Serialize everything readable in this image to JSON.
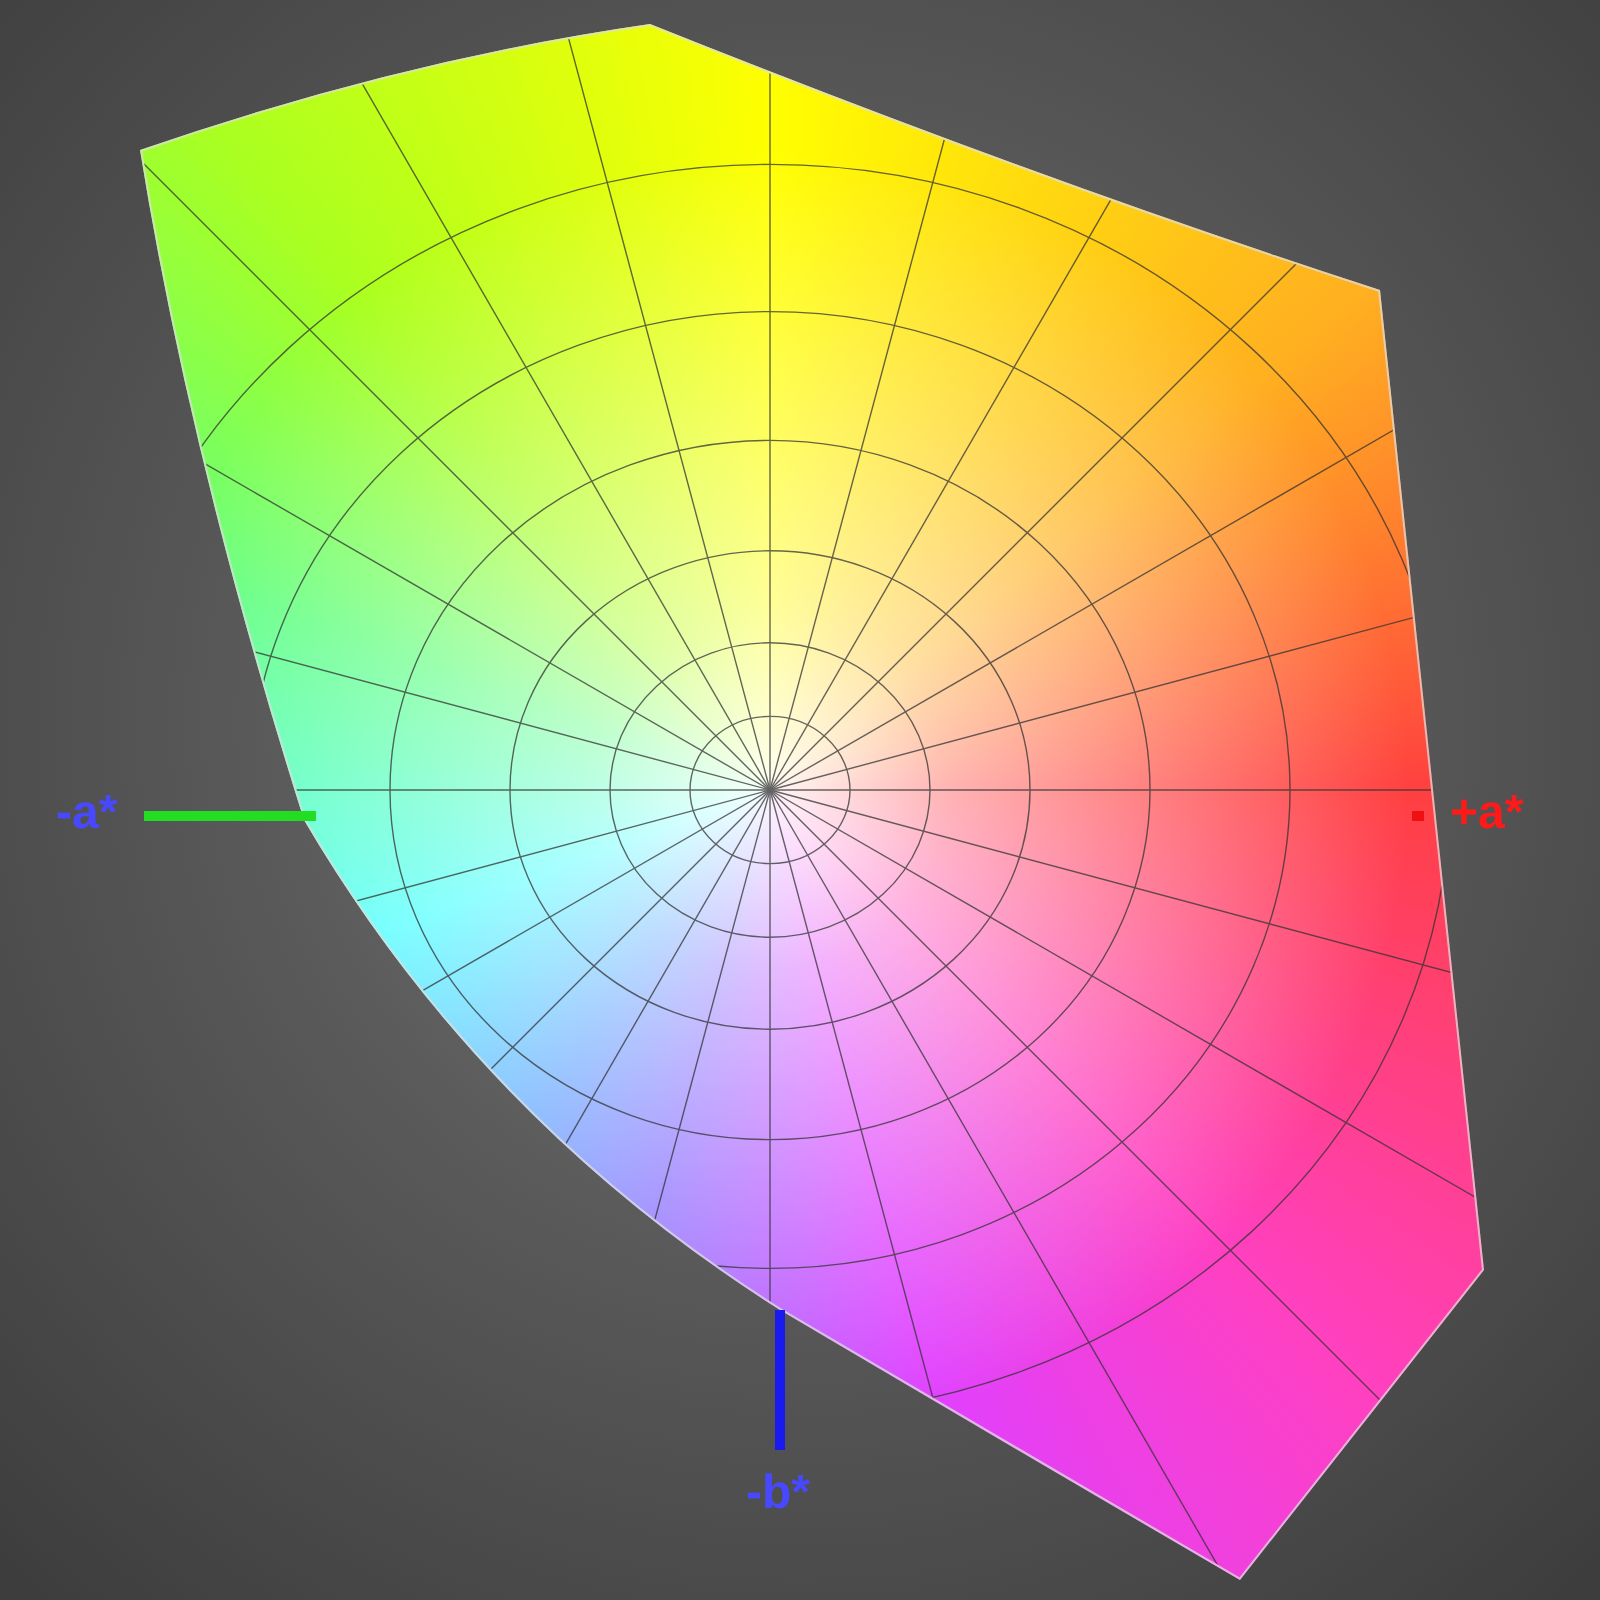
{
  "axes": [
    {
      "kind": "neg_a",
      "label": "-a*"
    },
    {
      "kind": "pos_a",
      "label": "+a*"
    },
    {
      "kind": "neg_b",
      "label": "-b*"
    }
  ]
}
